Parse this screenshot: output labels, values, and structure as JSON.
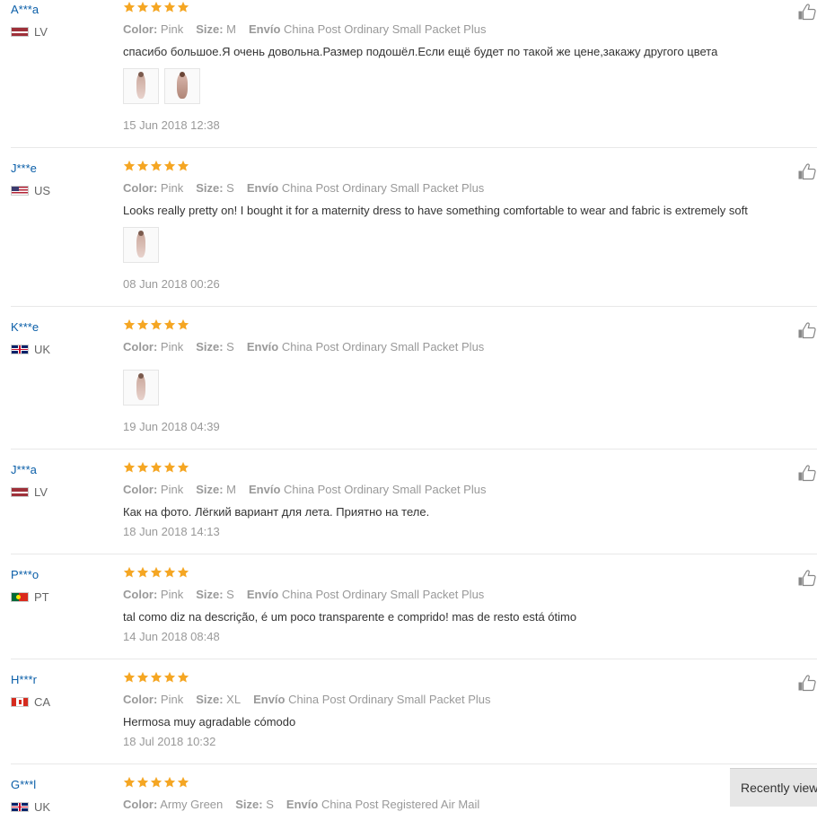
{
  "labels": {
    "color": "Color:",
    "size": "Size:",
    "shipping": "Envío"
  },
  "reviews": [
    {
      "user": "A***a",
      "country": "LV",
      "flag": "lv",
      "color": "Pink",
      "size": "M",
      "shipping": "China Post Ordinary Small Packet Plus",
      "content": "спасибо большое.Я очень довольна.Размер подошёл.Если ещё будет по такой же цене,закажу другого цвета",
      "photos": [
        "photo-1",
        "photo-2"
      ],
      "date": "15 Jun 2018 12:38",
      "rating": 5
    },
    {
      "user": "J***e",
      "country": "US",
      "flag": "us",
      "color": "Pink",
      "size": "S",
      "shipping": "China Post Ordinary Small Packet Plus",
      "content": "Looks really pretty on! I bought it for a maternity dress to have something comfortable to wear and fabric is extremely soft",
      "photos": [
        "photo-1"
      ],
      "date": "08 Jun 2018 00:26",
      "rating": 5
    },
    {
      "user": "K***e",
      "country": "UK",
      "flag": "uk",
      "color": "Pink",
      "size": "S",
      "shipping": "China Post Ordinary Small Packet Plus",
      "content": "",
      "photos": [
        "photo-1"
      ],
      "date": "19 Jun 2018 04:39",
      "rating": 5
    },
    {
      "user": "J***a",
      "country": "LV",
      "flag": "lv",
      "color": "Pink",
      "size": "M",
      "shipping": "China Post Ordinary Small Packet Plus",
      "content": "Как на фото. Лёгкий вариант для лета. Приятно на теле.",
      "photos": [],
      "date": "18 Jun 2018 14:13",
      "rating": 5
    },
    {
      "user": "P***o",
      "country": "PT",
      "flag": "pt",
      "color": "Pink",
      "size": "S",
      "shipping": "China Post Ordinary Small Packet Plus",
      "content": "tal como diz na descrição, é um poco transparente e comprido! mas de resto está ótimo",
      "photos": [],
      "date": "14 Jun 2018 08:48",
      "rating": 5
    },
    {
      "user": "H***r",
      "country": "CA",
      "flag": "ca",
      "color": "Pink",
      "size": "XL",
      "shipping": "China Post Ordinary Small Packet Plus",
      "content": "Hermosa muy agradable cómodo",
      "photos": [],
      "date": "18 Jul 2018 10:32",
      "rating": 5
    },
    {
      "user": "G***l",
      "country": "UK",
      "flag": "uk",
      "color": "Army Green",
      "size": "S",
      "shipping": "China Post Registered Air Mail",
      "content": "",
      "photos": [],
      "date": "",
      "rating": 5
    }
  ],
  "recently_viewed": {
    "label": "Recently view"
  },
  "colors": {
    "star": "#f5a623",
    "username": "#0a5ea8",
    "muted": "#999999"
  }
}
